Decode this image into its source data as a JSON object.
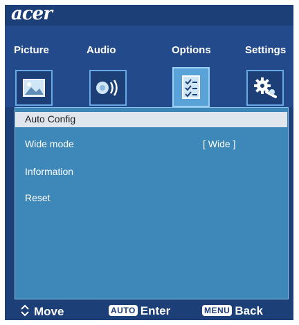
{
  "brand": {
    "logo_text": "acer"
  },
  "tabs": [
    {
      "label": "Picture",
      "icon": "picture-icon",
      "active": false
    },
    {
      "label": "Audio",
      "icon": "speaker-icon",
      "active": false
    },
    {
      "label": "Options",
      "icon": "checklist-icon",
      "active": true
    },
    {
      "label": "Settings",
      "icon": "gears-icon",
      "active": false
    }
  ],
  "menu": {
    "items": [
      {
        "label": "Auto Config",
        "value": "",
        "selected": true
      },
      {
        "label": "Wide mode",
        "value": "[ Wide ]",
        "selected": false
      },
      {
        "label": "Information",
        "value": "",
        "selected": false
      },
      {
        "label": "Reset",
        "value": "",
        "selected": false
      }
    ]
  },
  "footer": {
    "move_label": "Move",
    "auto_key": "AUTO",
    "enter_label": "Enter",
    "menu_key": "MENU",
    "back_label": "Back"
  },
  "colors": {
    "background": "#1d3f78",
    "panel": "#3e88b9",
    "highlight": "#dfe6ee",
    "active_tab": "#5aa3d8"
  }
}
